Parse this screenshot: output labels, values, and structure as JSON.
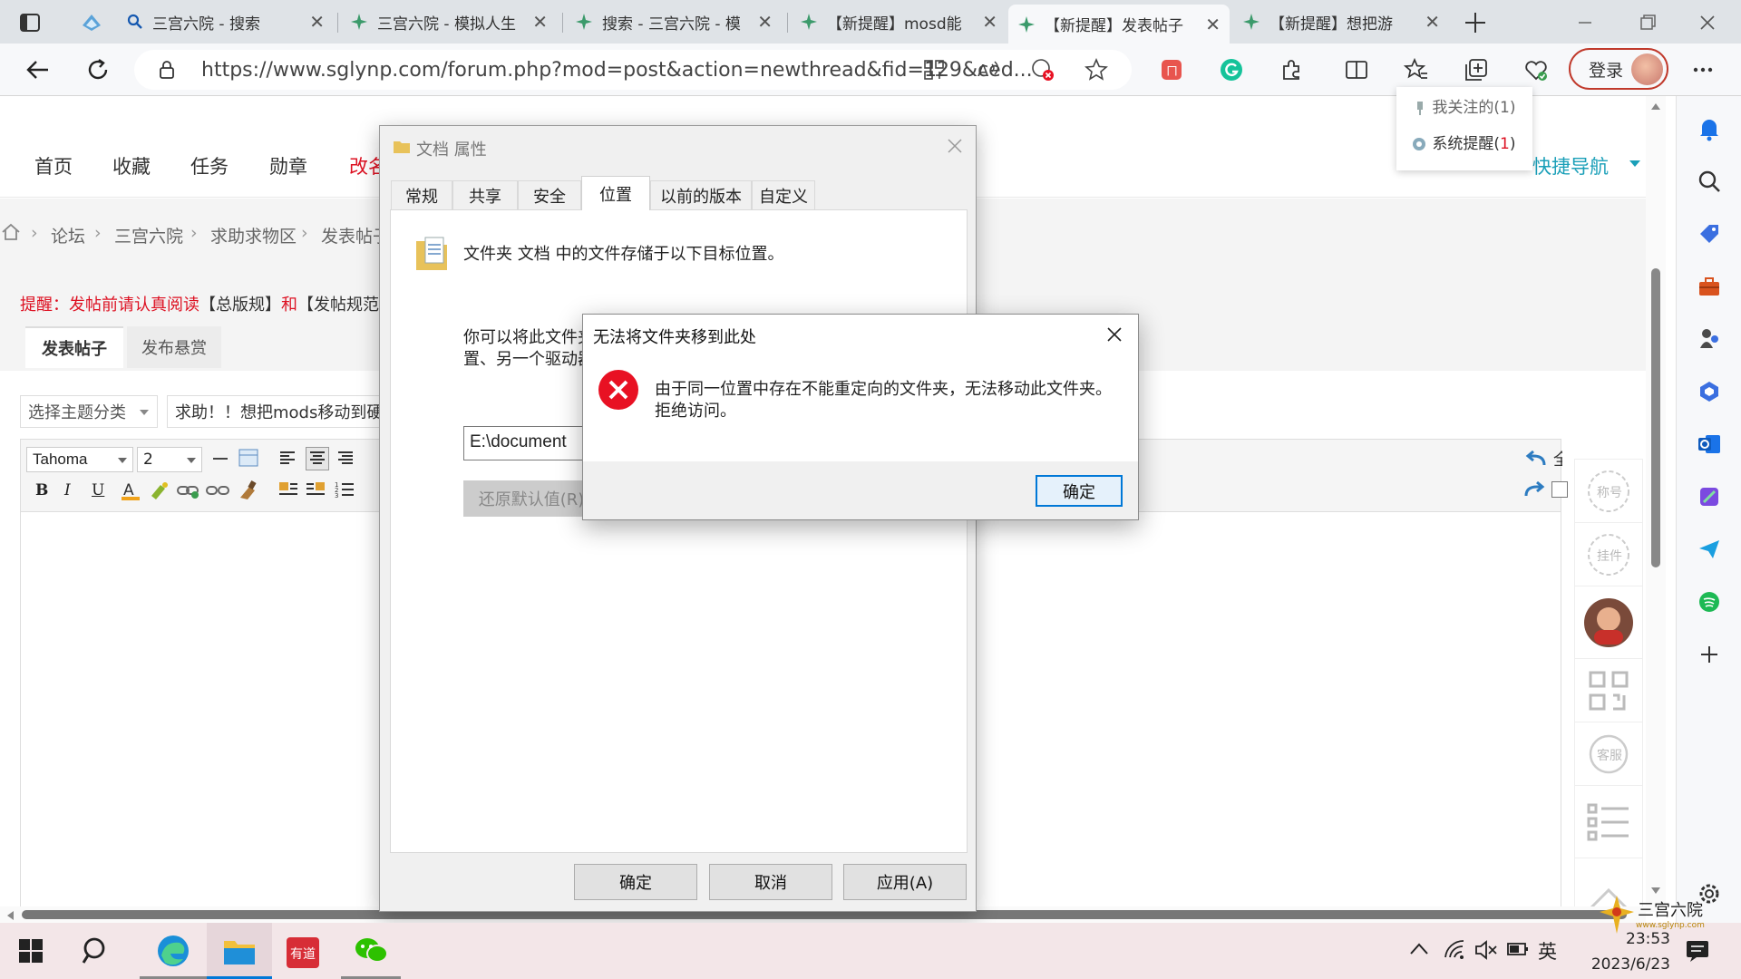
{
  "tabs": [
    {
      "label": "三宫六院 - 搜索"
    },
    {
      "label": "三宫六院 - 模拟人生"
    },
    {
      "label": "搜索 - 三宫六院 - 模"
    },
    {
      "label": "【新提醒】mosd能"
    },
    {
      "label": "【新提醒】发表帖子"
    },
    {
      "label": "【新提醒】想把游"
    }
  ],
  "address": {
    "url": "https://www.sglynp.com/forum.php?mod=post&action=newthread&fid=129&ced..."
  },
  "login_label": "登录",
  "notifications": {
    "followed": "我关注的(1)",
    "system_prefix": "系统提醒(",
    "system_count": "1",
    "system_suffix": ")"
  },
  "nav": {
    "items": [
      "首页",
      "收藏",
      "任务",
      "勋章",
      "改名"
    ],
    "quick_nav": "快捷导航"
  },
  "breadcrumb": {
    "items": [
      "论坛",
      "三宫六院",
      "求助求物区",
      "发表帖子"
    ]
  },
  "notice": {
    "prefix": "提醒：发帖前请认真阅读",
    "link1": "【总版规】",
    "and": "和",
    "link2": "【发帖规范"
  },
  "post_tabs": [
    "发表帖子",
    "发布悬赏"
  ],
  "thread_type": "选择主题分类",
  "thread_title": "求助！！想把mods移动到硬盘",
  "editor": {
    "font": "Tahoma",
    "size": "2",
    "right_label": "全屏"
  },
  "properties_dialog": {
    "title": "文档 属性",
    "tabs": [
      "常规",
      "共享",
      "安全",
      "位置",
      "以前的版本",
      "自定义"
    ],
    "selected_tab": "位置",
    "description": "文件夹 文档 中的文件存储于以下目标位置。",
    "para_line1": "你可以将此文件夹",
    "para_line2": "置、另一个驱动器",
    "path_value": "E:\\document",
    "restore_label": "还原默认值(R)",
    "ok": "确定",
    "cancel": "取消",
    "apply": "应用(A)"
  },
  "error_dialog": {
    "title": "无法将文件夹移到此处",
    "message": "由于同一位置中存在不能重定向的文件夹，无法移动此文件夹。",
    "message2": "拒绝访问。",
    "ok": "确定"
  },
  "sidebar_labels": {
    "badge": "称号",
    "plugin": "挂件",
    "service": "客服"
  },
  "taskbar": {
    "time": "23:53",
    "date": "2023/6/23",
    "ime": "英"
  },
  "watermark": {
    "brand": "三宫六院",
    "site": "www.sglynp.com"
  },
  "colors": {
    "accent": "#0078d7",
    "error": "#e81123",
    "notice": "#dd1111",
    "brand_red": "#c0392b",
    "quicknav": "#1a9fb8"
  }
}
